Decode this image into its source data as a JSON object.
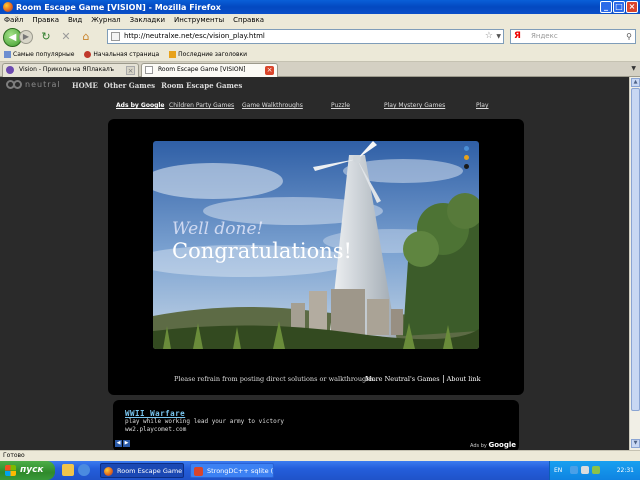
{
  "window": {
    "title": "Room Escape Game [VISION] - Mozilla Firefox",
    "buttons": [
      "_",
      "□",
      "×"
    ]
  },
  "menu": [
    {
      "label": "Файл"
    },
    {
      "label": "Правка"
    },
    {
      "label": "Вид"
    },
    {
      "label": "Журнал"
    },
    {
      "label": "Закладки"
    },
    {
      "label": "Инструменты"
    },
    {
      "label": "Справка"
    }
  ],
  "navbar": {
    "url": "http://neutralxe.net/esc/vision_play.html",
    "search_placeholder": "Яндекс",
    "search_engine_glyph": "Я"
  },
  "bookmarks": [
    {
      "label": "Самые популярные",
      "icon": "page-icon",
      "color": "#6d8fd0"
    },
    {
      "label": "Начальная страница",
      "icon": "flag-icon",
      "color": "#c0392b"
    },
    {
      "label": "Последние заголовки",
      "icon": "rss-icon",
      "color": "#e8a21b"
    }
  ],
  "tabs": [
    {
      "label": "Vision - Приколы на ЯПлакалъ",
      "active": false
    },
    {
      "label": "Room Escape Game [VISION]",
      "active": true
    }
  ],
  "site": {
    "logo_text": "neutral",
    "nav": [
      "HOME",
      "Other Games",
      "Room Escape Games"
    ],
    "ad_links": {
      "ads_by": "Ads by Google",
      "items": [
        "Children Party Games",
        "Game Walkthroughs",
        "Puzzle",
        "Play Mystery Games",
        "Play"
      ]
    },
    "game": {
      "message_1": "Well done!",
      "message_2": "Congratulations!",
      "indicator_colors": [
        "#4b8fd6",
        "#e8a21b",
        "#1a1a1a"
      ]
    },
    "note": "Please refrain from posting direct solutions or walkthroughs.",
    "more_games": "More Neutral's Games",
    "about": "About link",
    "ad": {
      "title": "WWII Warfare",
      "text": "play while working lead your army to victory",
      "url": "ww2.playcomet.com",
      "ads_by": "Ads by",
      "google": "Google"
    }
  },
  "status": "Готово",
  "taskbar": {
    "start": "пуск",
    "tasks": [
      "Room Escape Game [...",
      "StrongDC++ sqlite (..."
    ],
    "lang": "EN",
    "clock": "22:31"
  }
}
